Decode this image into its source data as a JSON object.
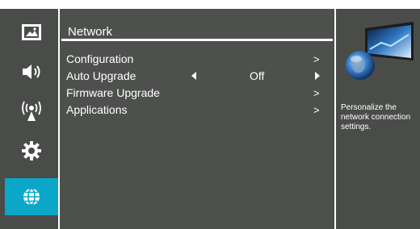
{
  "sidebar": {
    "items": [
      {
        "icon": "picture-icon",
        "active": false
      },
      {
        "icon": "speaker-icon",
        "active": false
      },
      {
        "icon": "broadcast-icon",
        "active": false
      },
      {
        "icon": "gear-icon",
        "active": false
      },
      {
        "icon": "globe-icon",
        "active": true
      }
    ],
    "accent_color": "#0aa7c8"
  },
  "main": {
    "title": "Network",
    "items": [
      {
        "label": "Configuration",
        "arrow": ">"
      },
      {
        "label": "Auto Upgrade",
        "value": "Off"
      },
      {
        "label": "Firmware Upgrade",
        "arrow": ">"
      },
      {
        "label": "Applications",
        "arrow": ">"
      }
    ]
  },
  "info": {
    "description": "Personalize the network connection settings."
  }
}
